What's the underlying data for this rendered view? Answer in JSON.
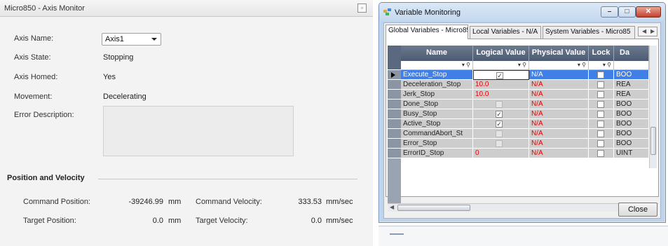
{
  "axis_monitor": {
    "title": "Micro850 - Axis Monitor",
    "fields": {
      "axis_name_label": "Axis Name:",
      "axis_name_value": "Axis1",
      "axis_state_label": "Axis State:",
      "axis_state_value": "Stopping",
      "axis_homed_label": "Axis Homed:",
      "axis_homed_value": "Yes",
      "movement_label": "Movement:",
      "movement_value": "Decelerating",
      "error_description_label": "Error Description:",
      "error_description_value": ""
    },
    "position_velocity": {
      "heading": "Position and Velocity",
      "command_position_label": "Command Position:",
      "command_position_value": "-39246.99",
      "command_position_unit": "mm",
      "target_position_label": "Target Position:",
      "target_position_value": "0.0",
      "target_position_unit": "mm",
      "command_velocity_label": "Command Velocity:",
      "command_velocity_value": "333.53",
      "command_velocity_unit": "mm/sec",
      "target_velocity_label": "Target Velocity:",
      "target_velocity_value": "0.0",
      "target_velocity_unit": "mm/sec"
    }
  },
  "variable_monitoring": {
    "title": "Variable Monitoring",
    "tabs": [
      {
        "label": "Global Variables - Micro850",
        "active": true
      },
      {
        "label": "Local Variables - N/A",
        "active": false
      },
      {
        "label": "System Variables - Micro85",
        "active": false
      }
    ],
    "columns": [
      "Name",
      "Logical Value",
      "Physical Value",
      "Lock",
      "Da"
    ],
    "filter_glyph": "▾ ⚲",
    "rows": [
      {
        "name": "Execute_Stop",
        "logical": "✓",
        "logical_kind": "checkbox",
        "physical": "N/A",
        "type": "BOO",
        "selected": true
      },
      {
        "name": "Deceleration_Stop",
        "logical": "10.0",
        "logical_kind": "number",
        "physical": "N/A",
        "type": "REA",
        "selected": false
      },
      {
        "name": "Jerk_Stop",
        "logical": "10.0",
        "logical_kind": "number",
        "physical": "N/A",
        "type": "REA",
        "selected": false
      },
      {
        "name": "Done_Stop",
        "logical": "",
        "logical_kind": "checkbox-disabled",
        "physical": "N/A",
        "type": "BOO",
        "selected": false
      },
      {
        "name": "Busy_Stop",
        "logical": "✓",
        "logical_kind": "checkbox",
        "physical": "N/A",
        "type": "BOO",
        "selected": false
      },
      {
        "name": "Active_Stop",
        "logical": "✓",
        "logical_kind": "checkbox",
        "physical": "N/A",
        "type": "BOO",
        "selected": false
      },
      {
        "name": "CommandAbort_St",
        "logical": "",
        "logical_kind": "checkbox-disabled",
        "physical": "N/A",
        "type": "BOO",
        "selected": false
      },
      {
        "name": "Error_Stop",
        "logical": "",
        "logical_kind": "checkbox-disabled",
        "physical": "N/A",
        "type": "BOO",
        "selected": false
      },
      {
        "name": "ErrorID_Stop",
        "logical": "0",
        "logical_kind": "number",
        "physical": "N/A",
        "type": "UINT",
        "selected": false
      }
    ],
    "close_label": "Close",
    "colors": {
      "selected_row": "#3f7fe6",
      "value_red": "#e00000",
      "header": "#5b6980"
    }
  }
}
